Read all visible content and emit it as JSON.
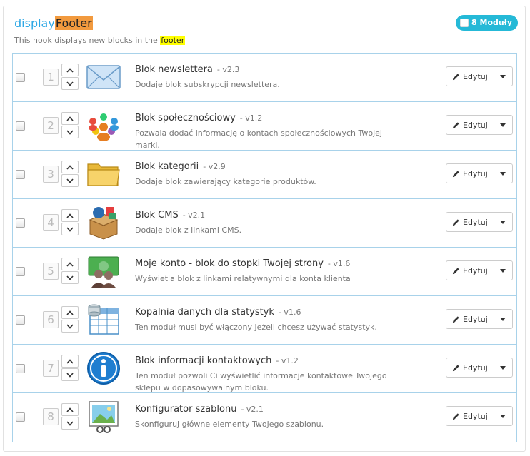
{
  "hook": {
    "title_prefix": "display",
    "title_highlight": "Footer",
    "desc_prefix": "This hook displays new blocks in the ",
    "desc_highlight": "footer",
    "badge": "8 Moduły"
  },
  "edit_label": "Edytuj",
  "modules": [
    {
      "pos": "1",
      "name": "Blok newslettera",
      "version": "- v2.3",
      "desc": "Dodaje blok subskrypcji newslettera.",
      "icon": "envelope-icon"
    },
    {
      "pos": "2",
      "name": "Blok społecznościowy",
      "version": "- v1.2",
      "desc": "Pozwala dodać informację o kontach społecznościowych Twojej marki.",
      "icon": "community-people-icon"
    },
    {
      "pos": "3",
      "name": "Blok kategorii",
      "version": "- v2.9",
      "desc": "Dodaje blok zawierający kategorie produktów.",
      "icon": "folder-icon"
    },
    {
      "pos": "4",
      "name": "Blok CMS",
      "version": "- v2.1",
      "desc": "Dodaje blok z linkami CMS.",
      "icon": "cms-box-icon"
    },
    {
      "pos": "5",
      "name": "Moje konto - blok do stopki Twojej strony",
      "version": "- v1.6",
      "desc": "Wyświetla blok z linkami relatywnymi dla konta klienta",
      "icon": "account-users-icon"
    },
    {
      "pos": "6",
      "name": "Kopalnia danych dla statystyk",
      "version": "- v1.6",
      "desc": "Ten moduł musi być włączony jeżeli chcesz używać statystyk.",
      "icon": "data-table-icon"
    },
    {
      "pos": "7",
      "name": "Blok informacji kontaktowych",
      "version": "- v1.2",
      "desc": "Ten moduł pozwoli Ci wyświetlić informacje kontaktowe Twojego sklepu w dopasowywalnym bloku.",
      "icon": "info-icon"
    },
    {
      "pos": "8",
      "name": "Konfigurator szablonu",
      "version": "- v2.1",
      "desc": "Skonfiguruj główne elementy Twojego szablonu.",
      "icon": "theme-image-icon"
    }
  ]
}
